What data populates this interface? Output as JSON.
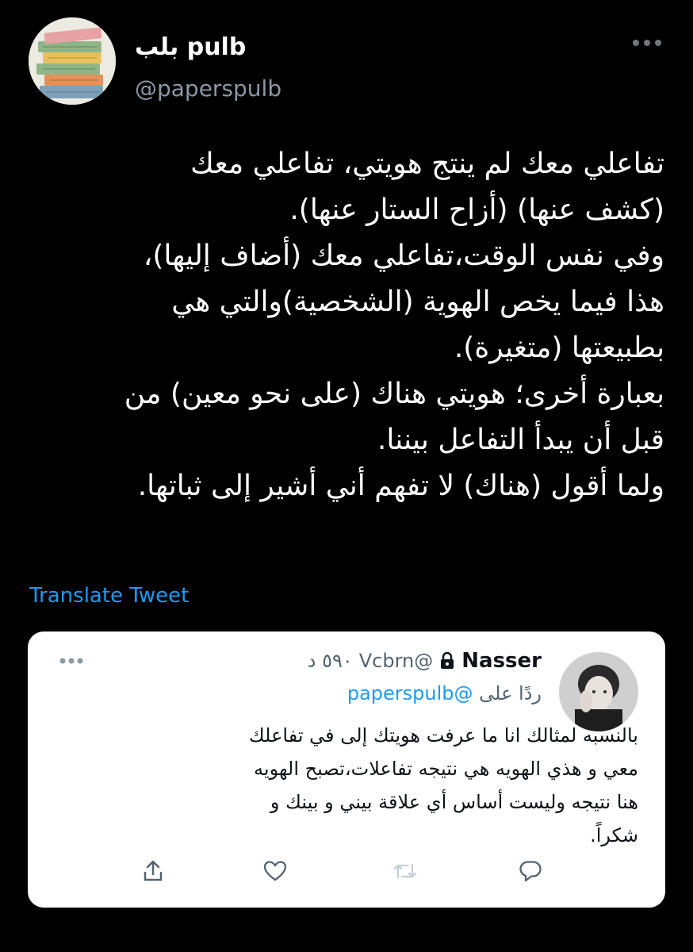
{
  "tweet": {
    "display_name": "بلب pulb",
    "handle": "@paperspulb",
    "text_lines": [
      "تفاعلي معك لم ينتج هويتي، تفاعلي معك",
      "(كشف عنها) (أزاح الستار عنها).",
      "وفي نفس الوقت،تفاعلي معك (أضاف إليها)،",
      "هذا فيما يخص الهوية (الشخصية)والتي هي",
      "بطبيعتها (متغيرة).",
      "بعبارة أخرى؛ هويتي هناك (على نحو معين) من",
      "قبل أن يبدأ التفاعل بيننا.",
      "ولما أقول (هناك) لا تفهم أني أشير إلى ثباتها."
    ],
    "translate_label": "Translate Tweet"
  },
  "quote": {
    "name": "Nasser",
    "handle": "@Vcbrn",
    "time": "٥٩٠ د",
    "reply_prefix": "ردًا على",
    "reply_mention": "@paperspulb",
    "text_lines": [
      "بالنسبه لمثالك انا ما عرفت هويتك إلى في تفاعلك",
      "معي و هذي الهويه هي نتيجه تفاعلات،تصبح الهويه",
      "هنا نتيجه وليست أساس أي علاقة بيني و بينك و",
      "شكراً."
    ],
    "actions": [
      "share-icon",
      "like-icon",
      "retweet-icon",
      "reply-icon"
    ]
  },
  "colors": {
    "background": "#000000",
    "link": "#1d9bf0",
    "secondary_text": "#8b98a5",
    "card_background": "#ffffff"
  }
}
